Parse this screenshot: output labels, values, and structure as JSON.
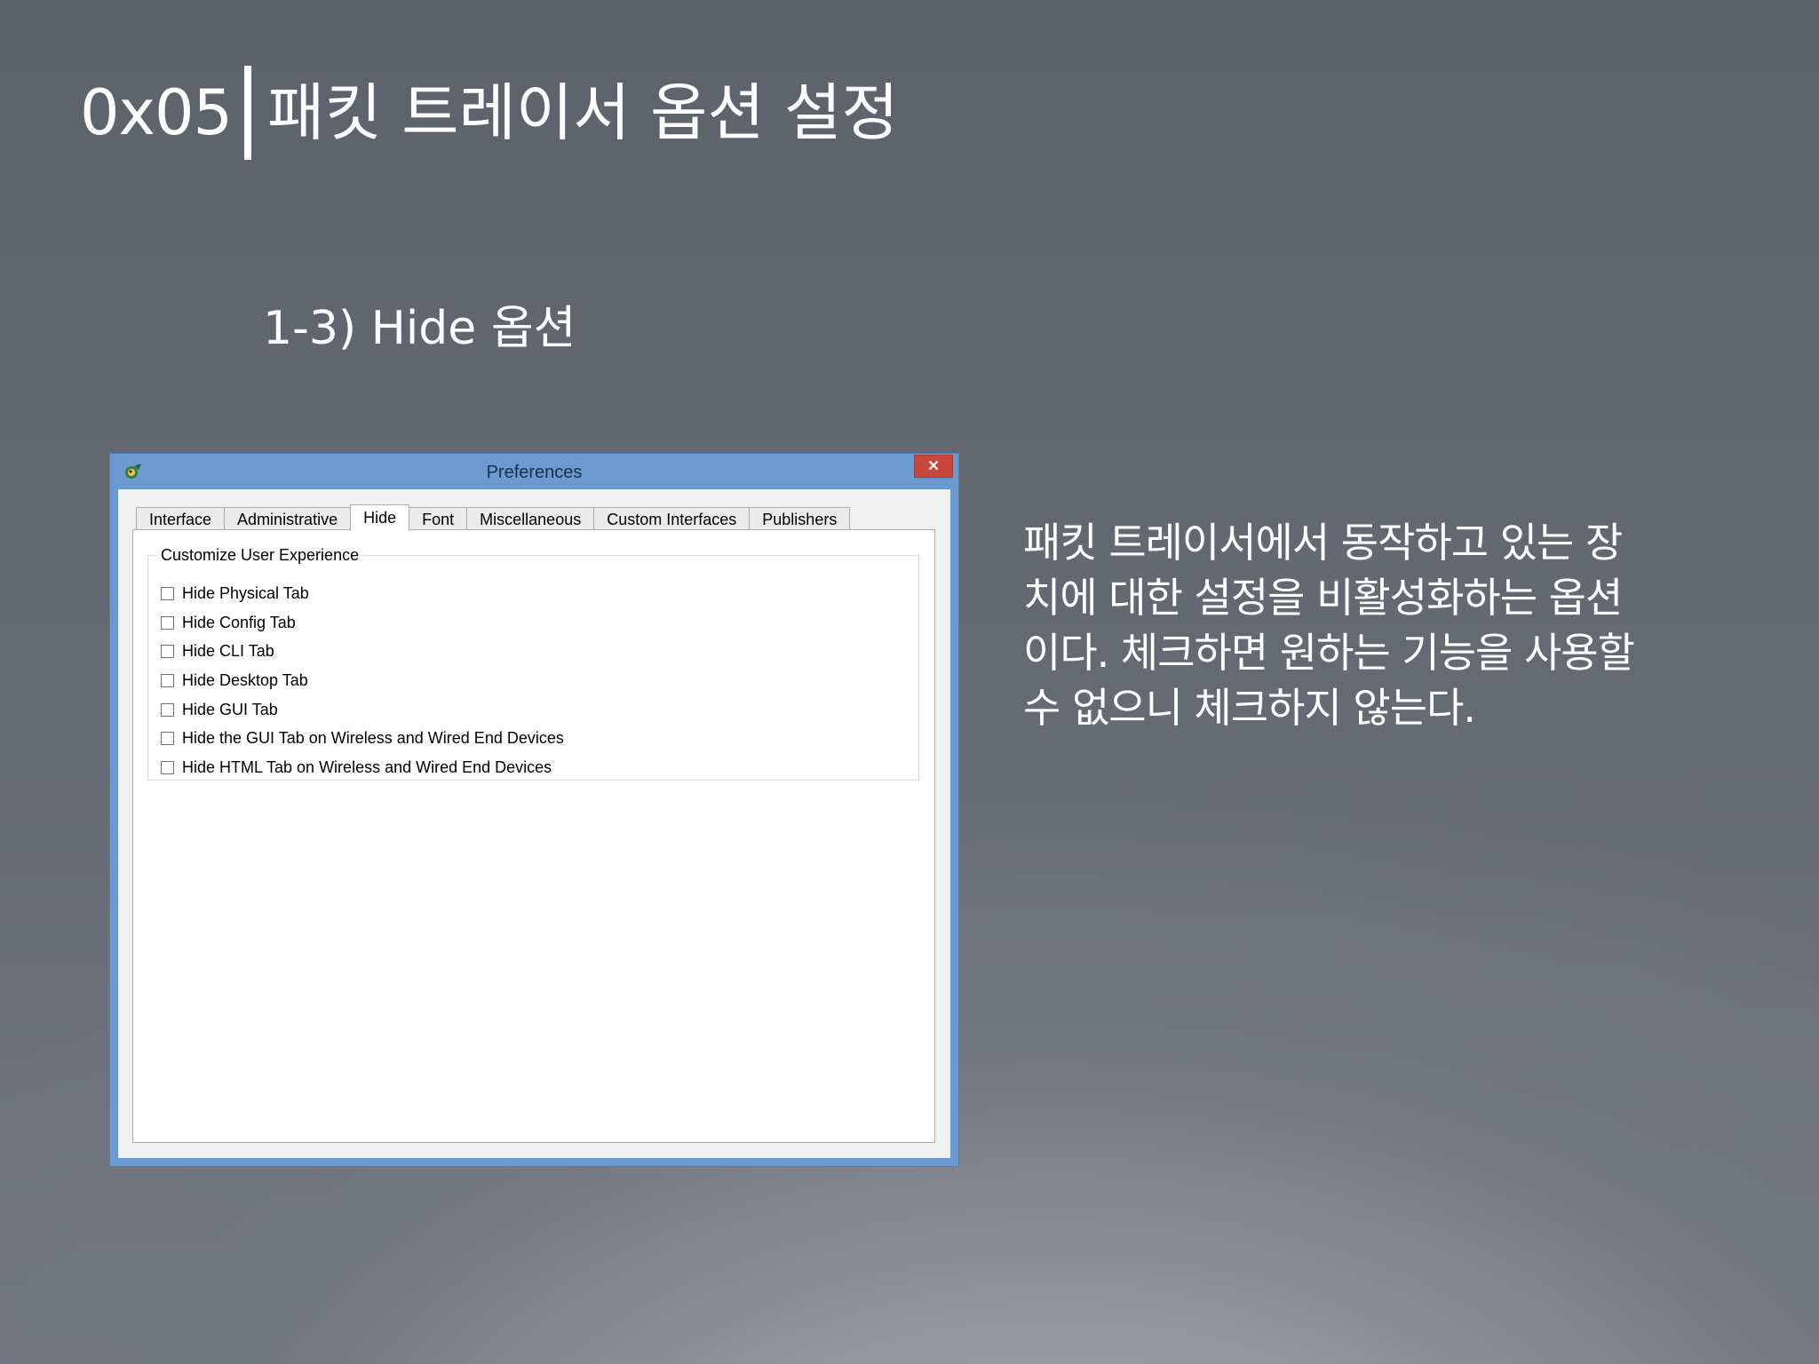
{
  "slide": {
    "code": "0x05",
    "title": "패킷 트레이서 옵션 설정",
    "subtitle": "1-3) Hide 옵션",
    "description_lines": [
      "패킷 트레이서에서 동작하고 있는 장",
      "치에 대한 설정을 비활성화하는 옵션",
      "이다. 체크하면 원하는 기능을 사용할",
      "수 없으니 체크하지 않는다."
    ]
  },
  "window": {
    "title": "Preferences",
    "close_symbol": "×",
    "icons": {
      "app": "packet-tracer-app-icon",
      "close": "close-icon"
    },
    "colors": {
      "frame": "#6b9ad0",
      "close": "#c9463d"
    },
    "tabs": [
      {
        "label": "Interface",
        "active": false
      },
      {
        "label": "Administrative",
        "active": false
      },
      {
        "label": "Hide",
        "active": true
      },
      {
        "label": "Font",
        "active": false
      },
      {
        "label": "Miscellaneous",
        "active": false
      },
      {
        "label": "Custom Interfaces",
        "active": false
      },
      {
        "label": "Publishers",
        "active": false
      }
    ],
    "group": {
      "title": "Customize User Experience",
      "options": [
        {
          "label": "Hide Physical Tab",
          "checked": false
        },
        {
          "label": "Hide Config Tab",
          "checked": false
        },
        {
          "label": "Hide CLI Tab",
          "checked": false
        },
        {
          "label": "Hide Desktop Tab",
          "checked": false
        },
        {
          "label": "Hide GUI Tab",
          "checked": false
        },
        {
          "label": "Hide the GUI Tab on Wireless and Wired End Devices",
          "checked": false
        },
        {
          "label": "Hide HTML Tab on Wireless and Wired End Devices",
          "checked": false
        }
      ]
    }
  }
}
